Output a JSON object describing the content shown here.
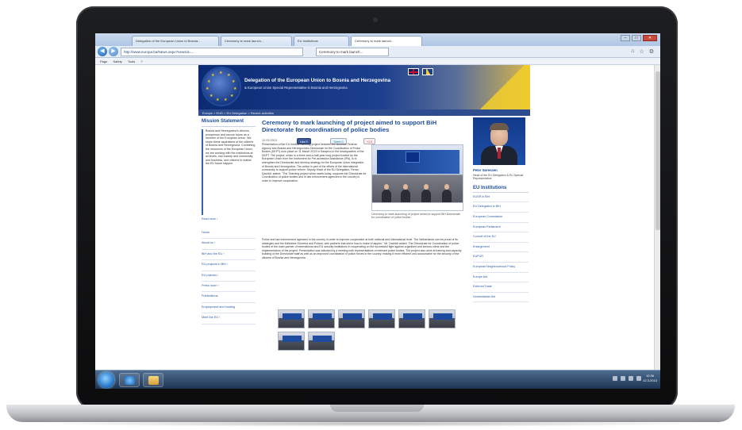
{
  "browser": {
    "tabs": [
      "Delegation of the European Union to Bosnia...",
      "Ceremony to mark launch...",
      "EU Institutions",
      "Ceremony to mark launch..."
    ],
    "url": "http://www.europa.ba/News.aspx?newsid=...",
    "active_tab_label": "Ceremony to mark launch...",
    "command_items": [
      "Page",
      "Safety",
      "Tools",
      "?"
    ]
  },
  "banner": {
    "title": "Delegation of the European Union to Bosnia and Herzegovina",
    "subtitle": "& European Union Special Representative in Bosnia and Herzegovina"
  },
  "breadcrumb": "Europe > EUD > EU Delegation > Recent activities",
  "left": {
    "mission_title": "Mission Statement",
    "mission_text": "Bosnia and Herzegovina's citizens, prosperous and secure future as a member of the European Union. We share these aspirations of the citizens of Bosnia and Herzegovina. Combining the resources of the European Union, we are working with the institutions at all levels, civil society and community, and business, and citizens to realise the EU future happen.",
    "read_more": "Read more ›",
    "menu": [
      "Home",
      "About us ›",
      "BiH and the EU ›",
      "EU projects in BiH ›",
      "EU policies ›",
      "Press room ›",
      "Publications",
      "Employment and funding",
      "Meet the EU ›"
    ]
  },
  "article": {
    "title": "Ceremony to mark launching of project aimed to support BiH Directorate for coordination of police bodies",
    "date": "12.03.2013",
    "share": {
      "facebook": "Like 0",
      "twitter": "Tweet 0",
      "google": "+1 0"
    },
    "intro": "Presentation of the EU funded Twinning project between the Austrian Federal Agency and Bosnia and Herzegovina's Directorate for the Coordination of Police Bodies (DKPT) took place on 11 March 2013 in Sarajevo in the headquarters of the DKPT. The project, which is a three-and-a-half-year long project funded by the European Union from the Instrument for Pre-accession Assistance (IPA), is to strengthen the Directorate and develop strategy for the European Union integration of Bosnia and Herzegovina. The action is part of the efforts of the international community to support police reform. Deputy Head of the EU Delegation, Renzo Daviddi, stated: \"The Twinning project which starts today, supports the Directorate for Coordination of police bodies and of law enforcement agencies in the country in order to improve cooperation.",
    "body": "Police and law enforcement agencies in the country in order to improve cooperation at both national and international level. The Netherlands can be proud of its strategies and the Ministries Slovenia and Poland, with partners that seem how to make it happen,\" Mr. Daviddi added. The Directorate for Coordination of police bodies of the main partner of international and EU security institutions in cooperating on the successful fight against organised and serious crime and the implementation of the project. Presentation was followed by a meeting with representatives of relevant police bodies. The project also aims at training and capacity building of the Directorate staff as well as an improved coordination of police forces in the country, making it more efficient and accountable for the security of the citizens of Bosnia and Herzegovina.",
    "photo_caption": "Ceremony to mark launching of project aimed to support BiH Directorate for coordination of police bodies"
  },
  "right": {
    "rep_name": "Peter Sørensen",
    "rep_title": "Head of the EU Delegation & EU Special Representative",
    "institutions_title": "EU Institutions",
    "institutions": [
      "EUSR in BiH",
      "EU Delegation in BiH",
      "European Commission",
      "European Parliament",
      "Council of the EU",
      "Enlargement",
      "EUFOR",
      "European Neighbourhood Policy",
      "Europe Aid",
      "External Trade",
      "Humanitarian Aid"
    ]
  },
  "taskbar": {
    "time": "10:36",
    "date": "12.3.2013"
  },
  "colors": {
    "accent": "#1c4e9b",
    "link": "#2b59a8",
    "banner": "#0c2a73"
  }
}
